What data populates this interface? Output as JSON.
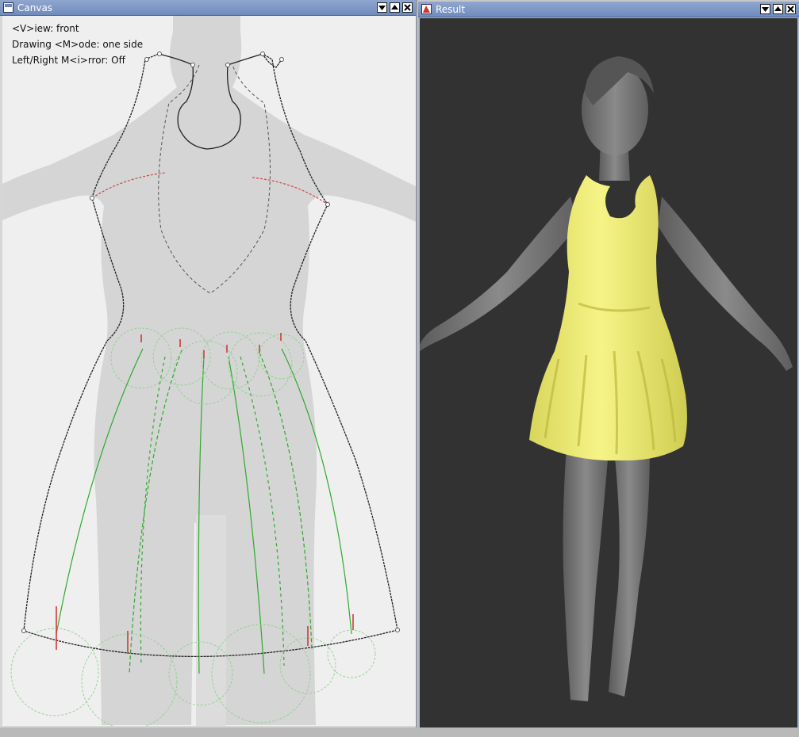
{
  "canvas_window": {
    "title": "Canvas",
    "overlay": {
      "view_line": "<V>iew: front",
      "mode_line": "Drawing <M>ode: one side",
      "mirror_line": "Left/Right M<i>rror: Off"
    }
  },
  "result_window": {
    "title": "Result"
  },
  "icons": {
    "window_buttons": [
      "minimize-icon",
      "maximize-icon",
      "close-icon"
    ]
  },
  "colors": {
    "dress": "#f0ee7c",
    "figure": "#6f6f6f",
    "viewport_bg": "#323232",
    "stroke_main": "#222222",
    "stroke_seam": "#2eaa2e",
    "stroke_red": "#d23a3a"
  }
}
